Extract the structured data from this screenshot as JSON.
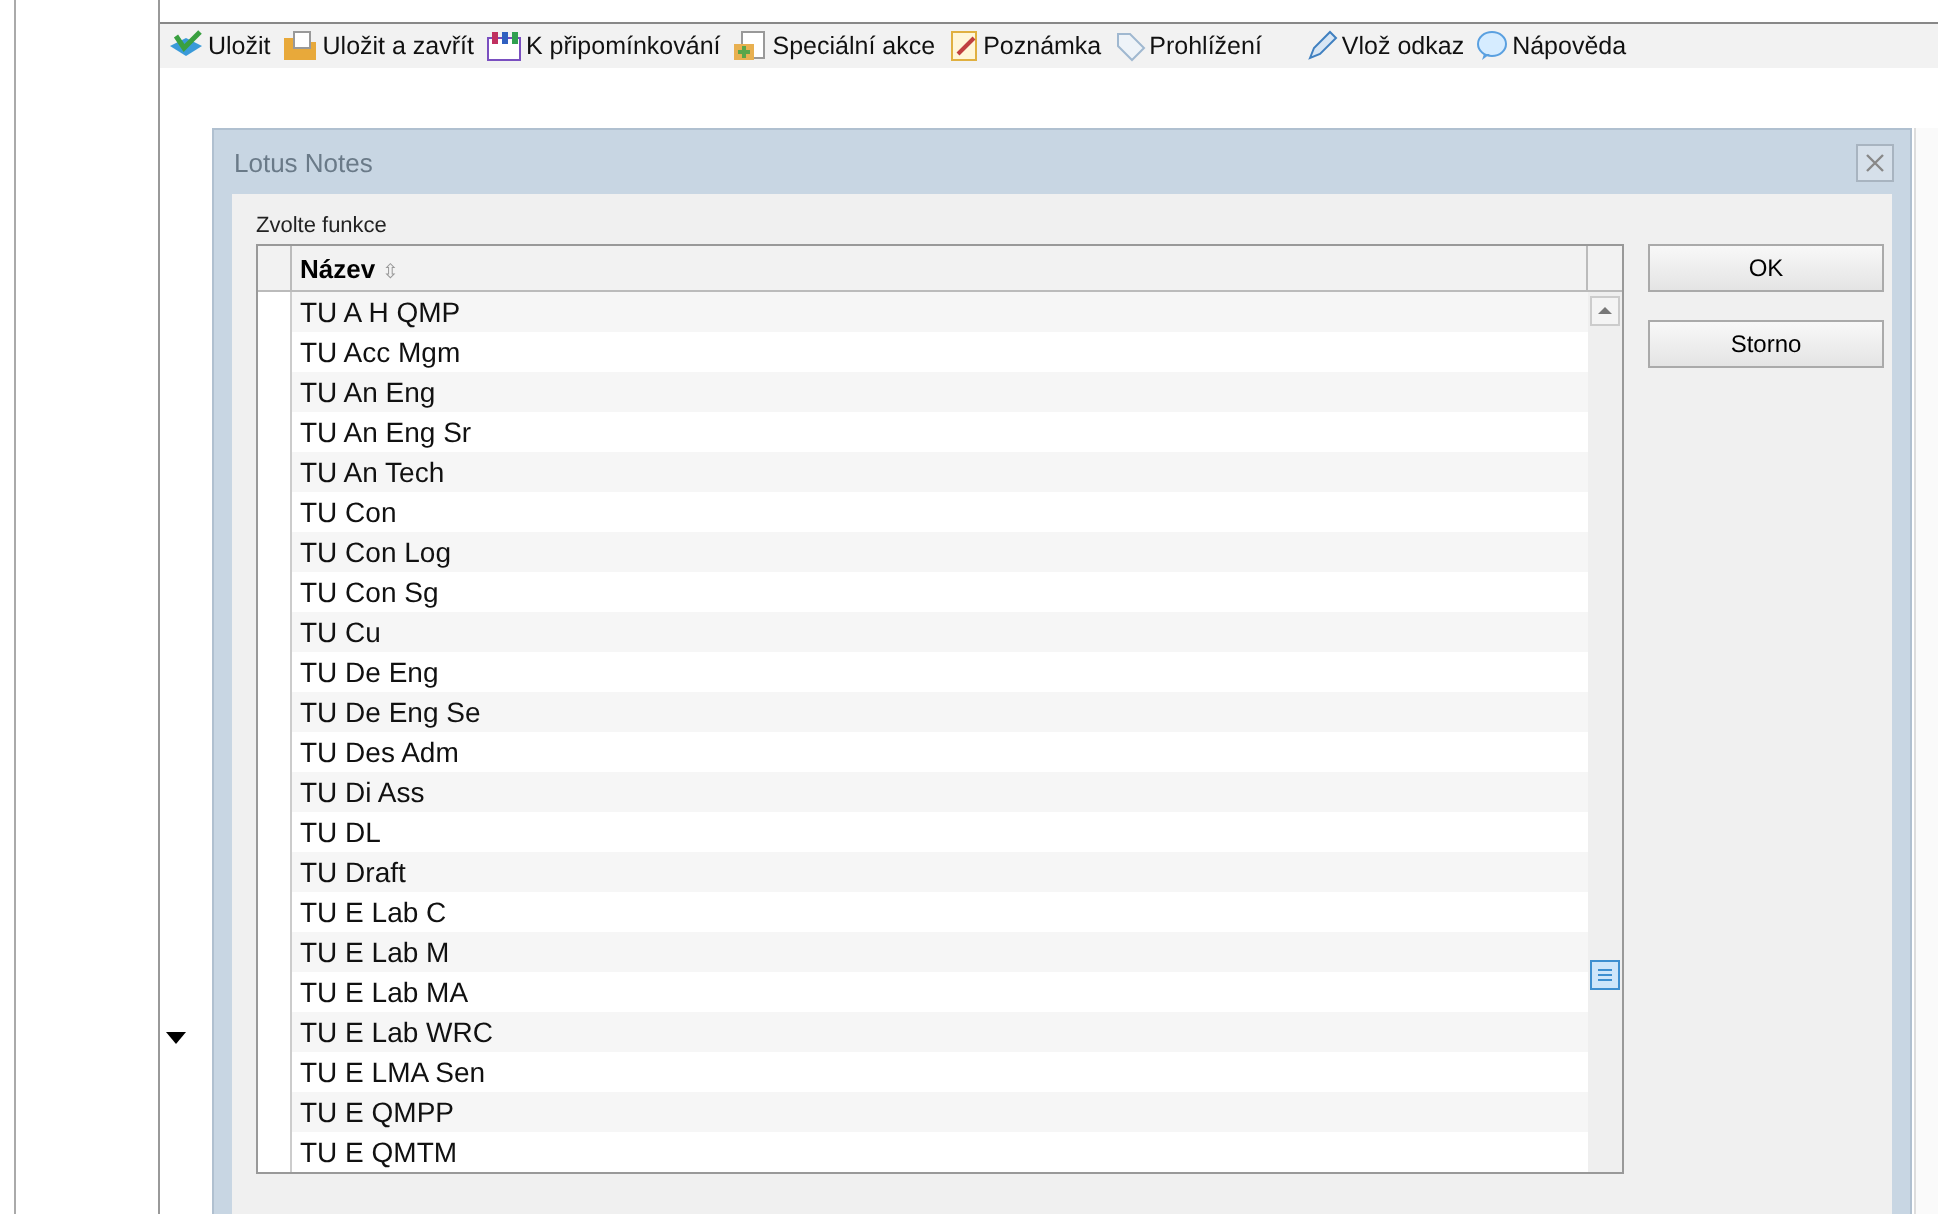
{
  "toolbar": [
    {
      "label": "Uložit",
      "kind": "save"
    },
    {
      "label": "Uložit a zavřít",
      "kind": "folder"
    },
    {
      "label": "K připomínkování",
      "kind": "people"
    },
    {
      "label": "Speciální akce",
      "kind": "action"
    },
    {
      "label": "Poznámka",
      "kind": "note"
    },
    {
      "label": "Prohlížení",
      "kind": "tag"
    },
    {
      "label": "Vlož odkaz",
      "kind": "pen"
    },
    {
      "label": "Nápověda",
      "kind": "bubble"
    }
  ],
  "dialog": {
    "title": "Lotus Notes",
    "prompt": "Zvolte funkce",
    "column": "Název",
    "sort_icon": "⇳",
    "rows": [
      "TU A H QMP",
      "TU Acc Mgm",
      "TU An Eng",
      "TU An Eng Sr",
      "TU An Tech",
      "TU Con",
      "TU Con Log",
      "TU Con Sg",
      "TU Cu",
      "TU De Eng",
      "TU De Eng Se",
      "TU Des Adm",
      "TU Di Ass",
      "TU DL",
      "TU Draft",
      "TU E Lab C",
      "TU E Lab M",
      "TU E Lab MA",
      "TU E Lab WRC",
      "TU E LMA Sen",
      "TU E QMPP",
      "TU E QMTM"
    ],
    "buttons": [
      "OK",
      "Storno"
    ]
  }
}
